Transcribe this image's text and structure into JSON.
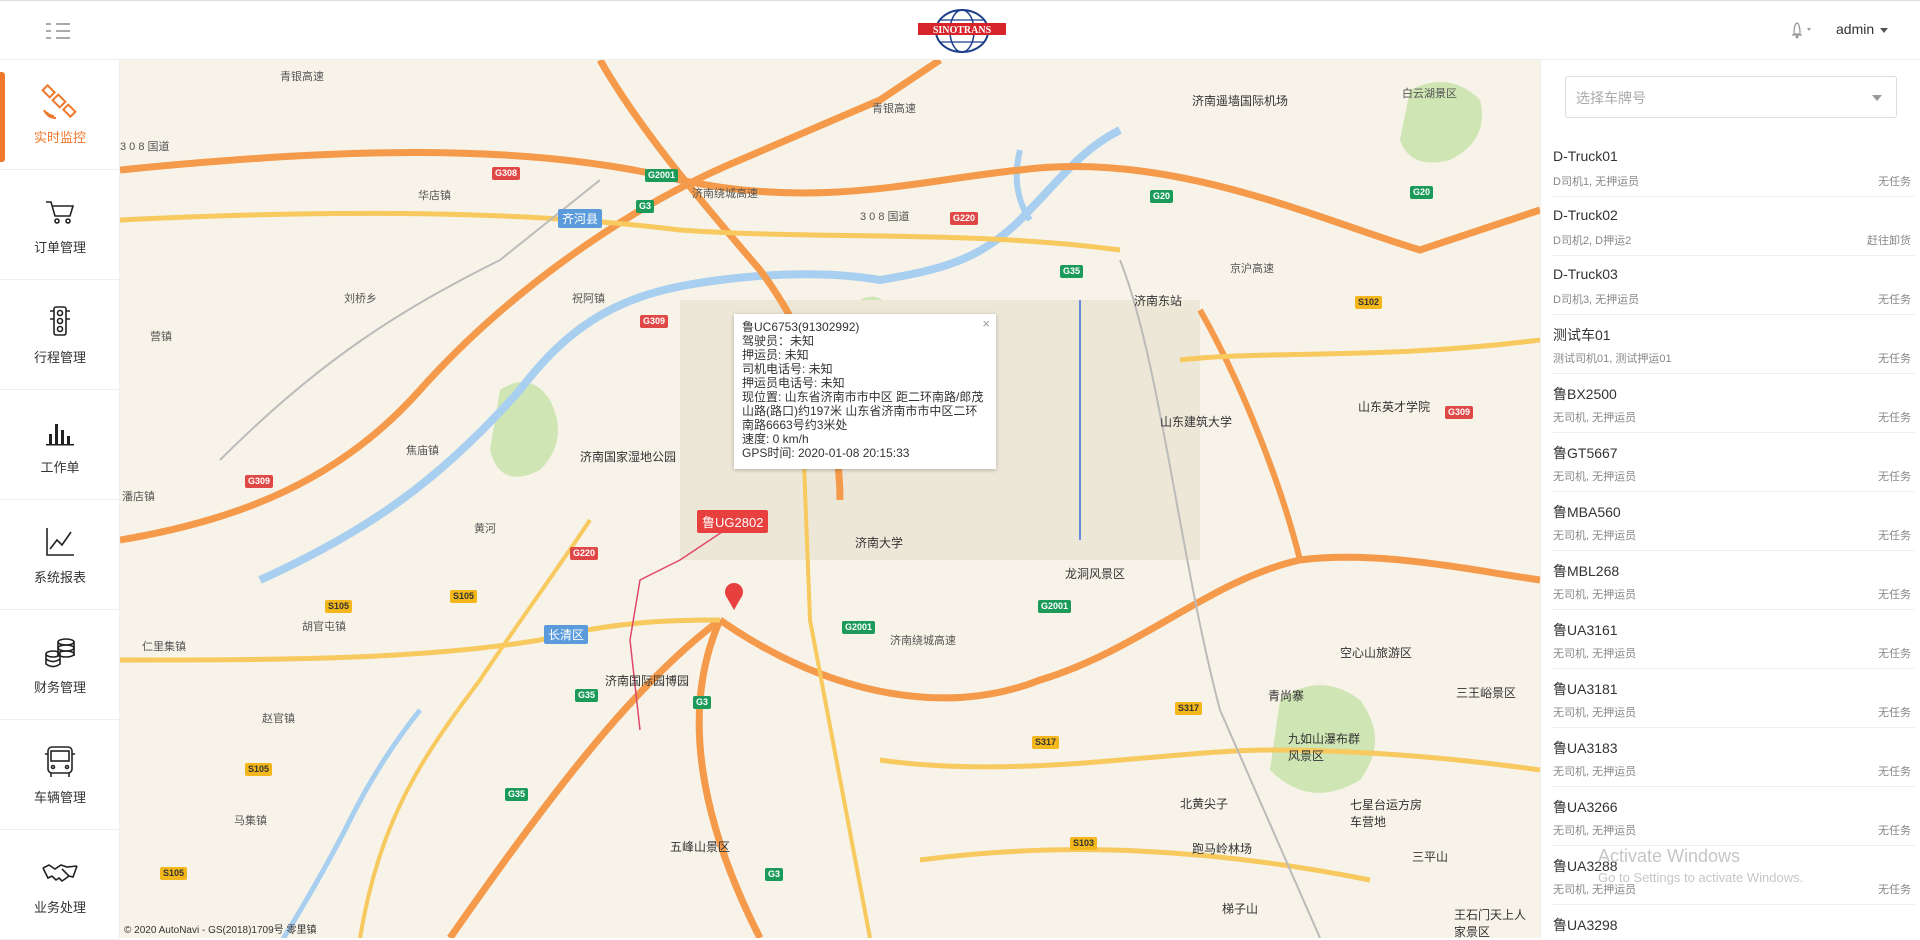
{
  "header": {
    "logo_text": "SINOTRANS",
    "user": "admin"
  },
  "sidebar": {
    "items": [
      {
        "label": "实时监控",
        "icon": "satellite-icon",
        "active": true
      },
      {
        "label": "订单管理",
        "icon": "cart-icon",
        "active": false
      },
      {
        "label": "行程管理",
        "icon": "traffic-light-icon",
        "active": false
      },
      {
        "label": "工作单",
        "icon": "bar-chart-icon",
        "active": false
      },
      {
        "label": "系统报表",
        "icon": "line-chart-icon",
        "active": false
      },
      {
        "label": "财务管理",
        "icon": "coins-icon",
        "active": false
      },
      {
        "label": "车辆管理",
        "icon": "bus-icon",
        "active": false
      },
      {
        "label": "业务处理",
        "icon": "handshake-icon",
        "active": false
      }
    ]
  },
  "map": {
    "labels": [
      {
        "t": "青银高速"
      },
      {
        "t": "济南遥墙国际机场"
      },
      {
        "t": "白云湖景区"
      },
      {
        "t": "青银高速"
      },
      {
        "t": "3 0 8 国道"
      },
      {
        "t": "华店镇"
      },
      {
        "t": "济南绕城高速"
      },
      {
        "t": "3 0 8 国道"
      },
      {
        "t": "刘桥乡"
      },
      {
        "t": "济南东站"
      },
      {
        "t": "济南国家湿地公园"
      },
      {
        "t": "山东建筑大学"
      },
      {
        "t": "山东英才学院"
      },
      {
        "t": "济南大学"
      },
      {
        "t": "龙洞风景区"
      },
      {
        "t": "济南国际园博园"
      },
      {
        "t": "空心山旅游区"
      },
      {
        "t": "青尚寨"
      },
      {
        "t": "三王峪景区"
      },
      {
        "t": "九如山瀑布群风景区"
      },
      {
        "t": "七星台运方房车营地"
      },
      {
        "t": "北黄尖子"
      },
      {
        "t": "跑马岭林场"
      },
      {
        "t": "五峰山景区"
      },
      {
        "t": "梯子山"
      },
      {
        "t": "三平山"
      },
      {
        "t": "王石门天上人家景区"
      },
      {
        "t": "胡官屯镇"
      },
      {
        "t": "仁里集镇"
      },
      {
        "t": "赵官镇"
      },
      {
        "t": "马集镇"
      },
      {
        "t": "潘店镇"
      },
      {
        "t": "焦庙镇"
      },
      {
        "t": "祝阿镇"
      },
      {
        "t": "营镇"
      },
      {
        "t": "黄河"
      },
      {
        "t": "济南绕城高速"
      },
      {
        "t": "京沪高速"
      }
    ],
    "districts": [
      "齐河县",
      "长清区"
    ],
    "copyright": "© 2020 AutoNavi - GS(2018)1709号 零里镇",
    "pin_label": "鲁UG2802"
  },
  "popup": {
    "title": "鲁UC6753(91302992)",
    "driver": "驾驶员：未知",
    "escort": "押运员: 未知",
    "driver_phone": "司机电话号: 未知",
    "escort_phone": "押运员电话号: 未知",
    "location": "现位置: 山东省济南市市中区 距二环南路/郎茂山路(路口)约197米 山东省济南市市中区二环南路6663号约3米处",
    "speed": "速度: 0 km/h",
    "gps_time": "GPS时间: 2020-01-08 20:15:33",
    "close": "×"
  },
  "panel": {
    "selector_placeholder": "选择车牌号",
    "vehicles": [
      {
        "name": "D-Truck01",
        "sub": "D司机1, 无押运员",
        "status": "无任务"
      },
      {
        "name": "D-Truck02",
        "sub": "D司机2, D押运2",
        "status": "赶往卸货"
      },
      {
        "name": "D-Truck03",
        "sub": "D司机3, 无押运员",
        "status": "无任务"
      },
      {
        "name": "测试车01",
        "sub": "测试司机01, 测试押运01",
        "status": "无任务"
      },
      {
        "name": "鲁BX2500",
        "sub": "无司机, 无押运员",
        "status": "无任务"
      },
      {
        "name": "鲁GT5667",
        "sub": "无司机, 无押运员",
        "status": "无任务"
      },
      {
        "name": "鲁MBA560",
        "sub": "无司机, 无押运员",
        "status": "无任务"
      },
      {
        "name": "鲁MBL268",
        "sub": "无司机, 无押运员",
        "status": "无任务"
      },
      {
        "name": "鲁UA3161",
        "sub": "无司机, 无押运员",
        "status": "无任务"
      },
      {
        "name": "鲁UA3181",
        "sub": "无司机, 无押运员",
        "status": "无任务"
      },
      {
        "name": "鲁UA3183",
        "sub": "无司机, 无押运员",
        "status": "无任务"
      },
      {
        "name": "鲁UA3266",
        "sub": "无司机, 无押运员",
        "status": "无任务"
      },
      {
        "name": "鲁UA3288",
        "sub": "无司机, 无押运员",
        "status": "无任务"
      },
      {
        "name": "鲁UA3298",
        "sub": "",
        "status": ""
      }
    ]
  },
  "watermark": {
    "line1": "Activate Windows",
    "line2": "Go to Settings to activate Windows."
  },
  "colors": {
    "accent": "#f0782d",
    "map_bg": "#f7f3e8",
    "road_highway": "#f49a4a",
    "road_major": "#f7c95e",
    "water": "#a8cff0",
    "park": "#cfe5b4"
  }
}
